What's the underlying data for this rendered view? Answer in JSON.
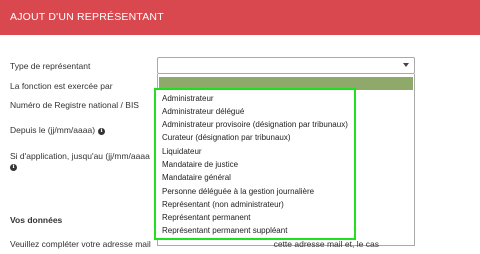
{
  "header": {
    "title": "AJOUT D'UN REPRÉSENTANT"
  },
  "form": {
    "type_label": "Type de représentant",
    "fonction_label": "La fonction est exercée par",
    "registre_label": "Numéro de Registre national / BIS",
    "depuis_label": "Depuis le (jj/mm/aaaa)",
    "jusquau_label": "Si d'application, jusqu'au (jj/mm/aaaa",
    "select_value": ""
  },
  "icons": {
    "info": "info-circle-icon",
    "caret": "caret-down-icon"
  },
  "dropdown": {
    "options": [
      "Administrateur",
      "Administrateur délégué",
      "Administrateur provisoire (désignation par tribunaux)",
      "Curateur (désignation par tribunaux)",
      "Liquidateur",
      "Mandataire de justice",
      "Mandataire général",
      "Personne déléguée à la gestion journalière",
      "Représentant (non administrateur)",
      "Représentant permanent",
      "Représentant permanent suppléant"
    ]
  },
  "section": {
    "title": "Vos données",
    "paragraph": "Veuillez compléter votre adresse mail                                                    cette adresse mail et, le cas"
  },
  "colors": {
    "header_bg": "#d9484f",
    "highlight": "#8fa96b",
    "frame": "#22dd22"
  }
}
